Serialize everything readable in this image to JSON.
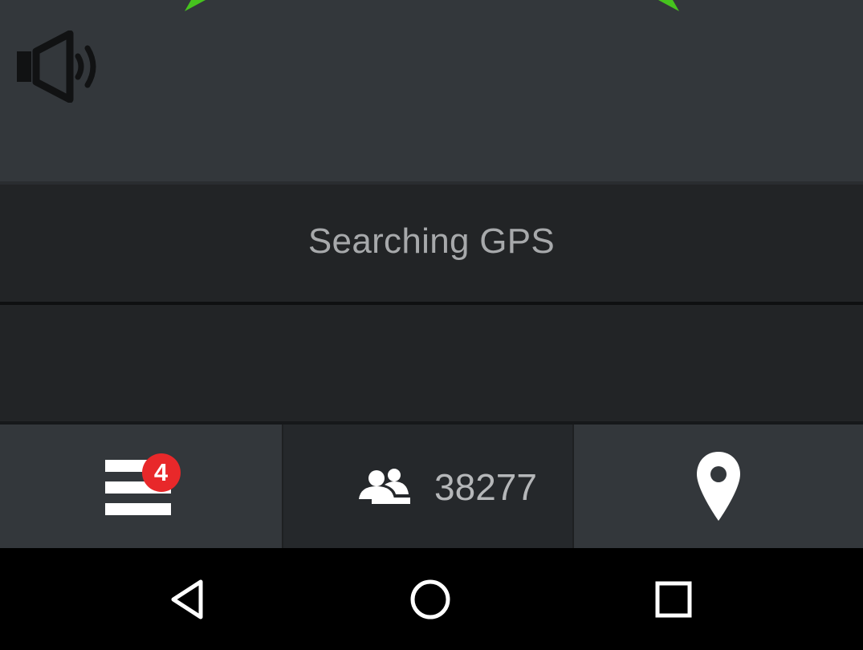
{
  "map": {
    "accent_color": "#46c31e",
    "sound_icon": "speaker-icon"
  },
  "status": {
    "text": "Searching GPS"
  },
  "toolbar": {
    "menu": {
      "icon": "menu-icon",
      "badge_count": "4"
    },
    "users": {
      "icon": "users-icon",
      "count": "38277"
    },
    "location": {
      "icon": "location-pin-icon"
    }
  },
  "nav": {
    "back_icon": "back-icon",
    "home_icon": "home-icon",
    "recents_icon": "recents-icon"
  },
  "colors": {
    "panel": "#33373b",
    "dark_panel": "#222426",
    "badge": "#e8282a",
    "text_muted": "#a7a9ab"
  }
}
